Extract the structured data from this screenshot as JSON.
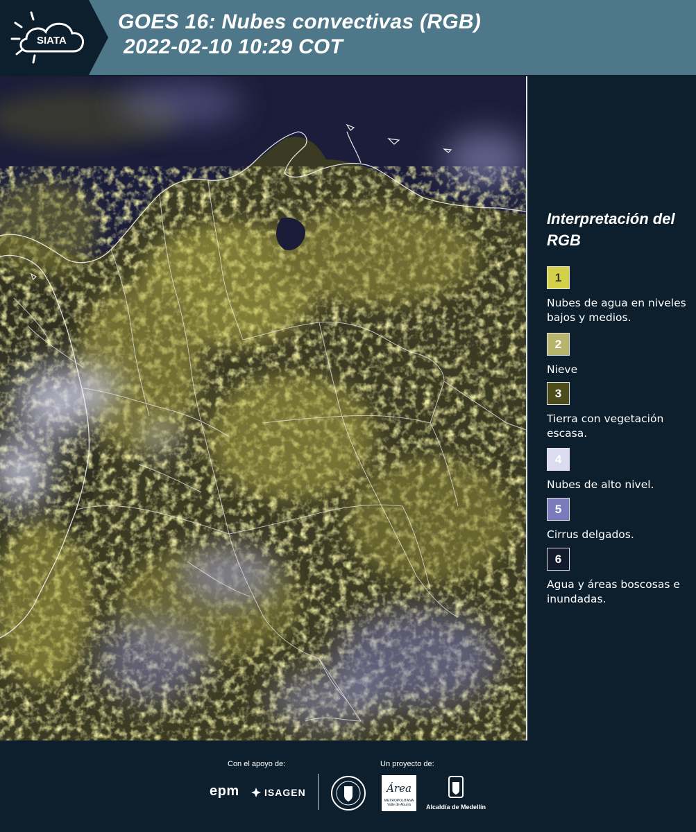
{
  "header": {
    "logo_text": "SIATA",
    "title_line1": "GOES 16: Nubes convectivas (RGB)",
    "title_line2": "2022-02-10 10:29 COT"
  },
  "legend": {
    "title": "Interpretación del RGB",
    "items": [
      {
        "number": "1",
        "color": "#d4d04a",
        "number_color": "#3a3a20",
        "label": "Nubes de agua en niveles bajos y medios."
      },
      {
        "number": "2",
        "color": "#b7b56c",
        "number_color": "#ffffff",
        "label": "Nieve"
      },
      {
        "number": "3",
        "color": "#4c4c1c",
        "number_color": "#ffffff",
        "label": "Tierra con vegetación escasa."
      },
      {
        "number": "4",
        "color": "#dcdcf0",
        "number_color": "#ffffff",
        "label": "Nubes de alto nivel."
      },
      {
        "number": "5",
        "color": "#7a7abd",
        "number_color": "#ffffff",
        "label": "Cirrus delgados."
      },
      {
        "number": "6",
        "color": "#141a2e",
        "number_color": "#ffffff",
        "label": "Agua y áreas boscosas e inundadas."
      }
    ]
  },
  "footer": {
    "support_label": "Con el apoyo de:",
    "project_label": "Un proyecto de:",
    "sponsors": [
      "epm",
      "ISAGEN"
    ],
    "partners": [
      "Área Metropolitana Valle de Aburrá",
      "Alcaldía de Medellín"
    ],
    "partner_area_name": "Área",
    "partner_area_sub": "METROPOLITANA",
    "partner_area_sub2": "Valle de Aburrá",
    "partner_alcaldia": "Alcaldía de Medellín"
  },
  "colors": {
    "header_bg": "#4e7789",
    "panel_bg": "#0d1f2d",
    "ocean": "#1c1f3c",
    "land_yellow": "#b9b54a",
    "cloud_white": "#e6e6f4"
  },
  "map": {
    "projection_note_visible": false
  }
}
